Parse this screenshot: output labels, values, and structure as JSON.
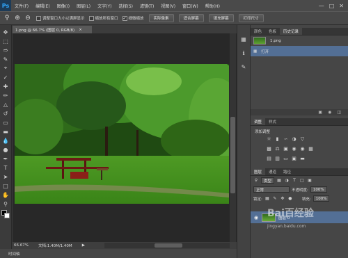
{
  "app": {
    "logo": "Ps"
  },
  "menu": [
    "文件(F)",
    "编辑(E)",
    "图像(I)",
    "图层(L)",
    "文字(Y)",
    "选择(S)",
    "滤镜(T)",
    "视图(V)",
    "窗口(W)",
    "帮助(H)"
  ],
  "window_controls": {
    "minimize": "—",
    "maximize": "□",
    "close": "✕"
  },
  "options": {
    "check_resize_window": "调整窗口大小以满屏显示",
    "check_zoom_all": "缩放所有窗口",
    "check_scrubby": "细微缩放",
    "btn_actual_pixels": "实际像素",
    "btn_fit_screen": "适合屏幕",
    "btn_fill_screen": "填充屏幕",
    "btn_print_size": "打印尺寸"
  },
  "document": {
    "tab_title": "1.png @ 66.7% (图层 0, RGB/8)",
    "tab_close": "×"
  },
  "status": {
    "zoom": "66.67%",
    "doc_size": "文档:1.40M/1.40M",
    "arrow": "▶"
  },
  "bottom_strip": {
    "label": "时间轴"
  },
  "history": {
    "tabs": [
      "颜色",
      "色板",
      "历史记录"
    ],
    "snapshot": "1.png",
    "step": "打开"
  },
  "adjustments": {
    "tabs": [
      "调整",
      "样式"
    ],
    "title": "添加调整"
  },
  "layers": {
    "tabs": [
      "图层",
      "通道",
      "路径"
    ],
    "filter_kind": "类型",
    "blend_mode": "正常",
    "opacity_label": "不透明度:",
    "opacity_value": "100%",
    "lock_label": "锁定:",
    "fill_label": "填充:",
    "fill_value": "100%",
    "layer_name": "图层 0"
  },
  "watermark": {
    "logo": "Bai百经验",
    "url": "jingyan.baidu.com"
  },
  "colors": {
    "selection": "#536f95",
    "panel": "#464646",
    "canvas_bg": "#282828"
  }
}
